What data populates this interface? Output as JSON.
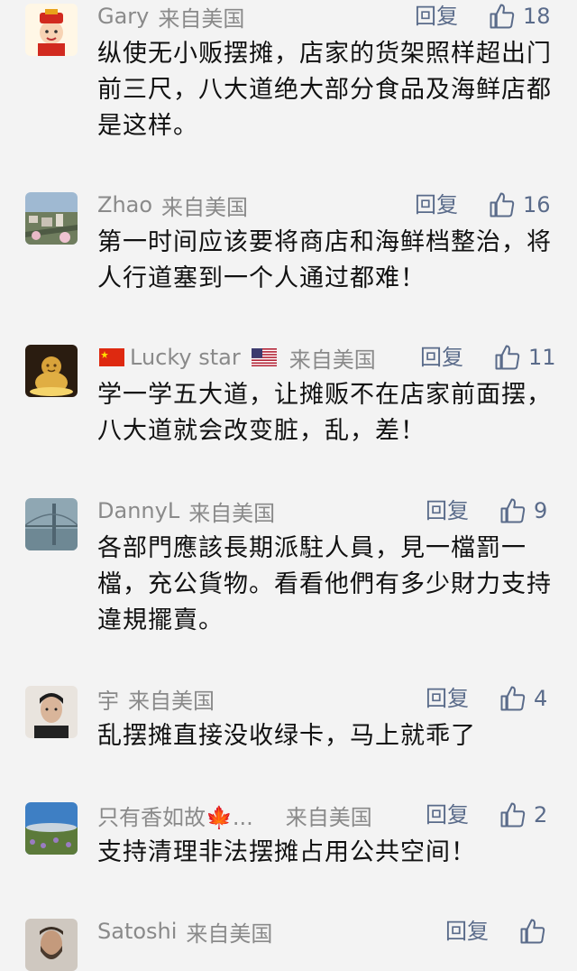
{
  "comments": [
    {
      "user": "Gary",
      "location": "来自美国",
      "reply": "回复",
      "likes": "18",
      "text": "纵使无小贩摆摊，店家的货架照样超出门前三尺，八大道绝大部分食品及海鲜店都是这样。",
      "avatar": "god-of-wealth-avatar"
    },
    {
      "user": "Zhao",
      "location": "来自美国",
      "reply": "回复",
      "likes": "16",
      "text": "第一时间应该要将商店和海鲜档整治，将人行道塞到一个人通过都难！",
      "avatar": "city-view-avatar"
    },
    {
      "user": "Lucky star",
      "location": "来自美国",
      "reply": "回复",
      "likes": "11",
      "text": "学一学五大道，让摊贩不在店家前面摆，八大道就会改变脏，乱，差！",
      "avatar": "golden-buddha-avatar"
    },
    {
      "user": "DannyL",
      "location": "来自美国",
      "reply": "回复",
      "likes": "9",
      "text": "各部門應該長期派駐人員，見一檔罰一檔，充公貨物。看看他們有多少財力支持違規擺賣。",
      "avatar": "bridge-fog-avatar"
    },
    {
      "user": "宇",
      "location": "来自美国",
      "reply": "回复",
      "likes": "4",
      "text": "乱摆摊直接没收绿卡，马上就乖了",
      "avatar": "man-portrait-avatar"
    },
    {
      "user": "只有香如故🍁...",
      "location": "来自美国",
      "reply": "回复",
      "likes": "2",
      "text": "支持清理非法摆摊占用公共空间！",
      "avatar": "field-sky-avatar"
    },
    {
      "user": "Satoshi",
      "location": "来自美国",
      "reply": "回复",
      "likes": "",
      "text": "",
      "avatar": "bearded-man-avatar"
    }
  ],
  "colors": {
    "name": "#8a8a8a",
    "action": "#5a6b8a",
    "text": "#111111",
    "background": "#f3f3f3"
  }
}
